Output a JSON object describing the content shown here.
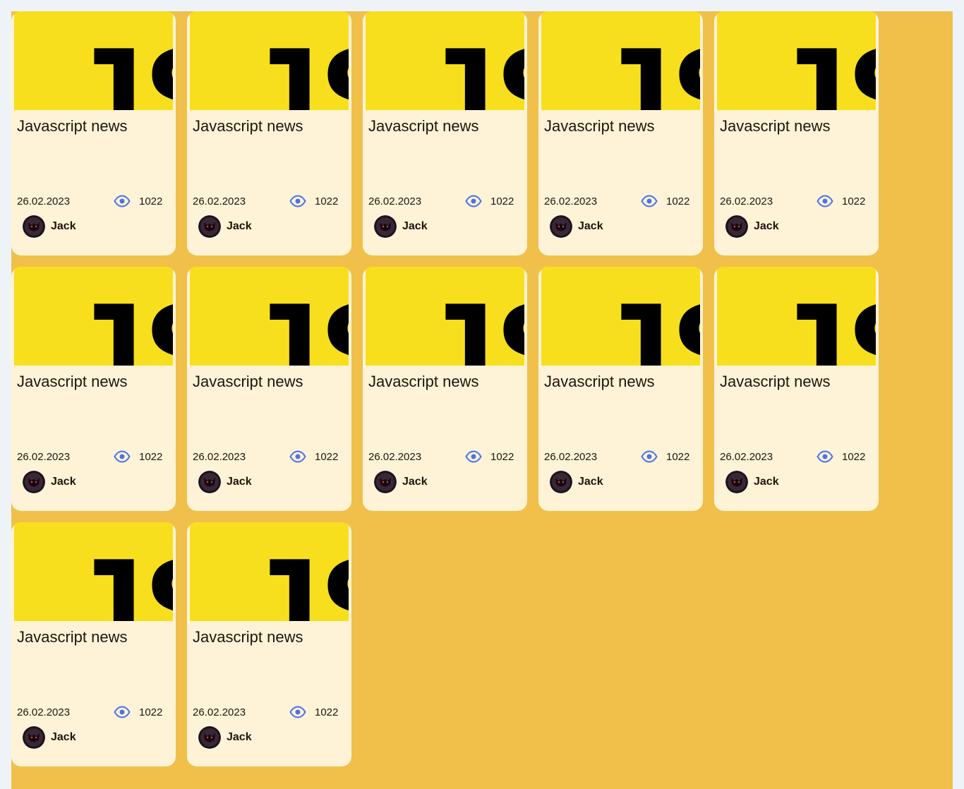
{
  "page": {
    "background_color": "#eef3f7",
    "board_color": "#f0c04a",
    "card_color": "#fff3d7",
    "accent_color": "#4b74e6",
    "thumbnail_color": "#f7df1e"
  },
  "cards": [
    {
      "thumbnail_text": "JS",
      "title": "Javascript news",
      "date": "26.02.2023",
      "views": "1022",
      "author": "Jack"
    },
    {
      "thumbnail_text": "JS",
      "title": "Javascript news",
      "date": "26.02.2023",
      "views": "1022",
      "author": "Jack"
    },
    {
      "thumbnail_text": "JS",
      "title": "Javascript news",
      "date": "26.02.2023",
      "views": "1022",
      "author": "Jack"
    },
    {
      "thumbnail_text": "JS",
      "title": "Javascript news",
      "date": "26.02.2023",
      "views": "1022",
      "author": "Jack"
    },
    {
      "thumbnail_text": "JS",
      "title": "Javascript news",
      "date": "26.02.2023",
      "views": "1022",
      "author": "Jack"
    },
    {
      "thumbnail_text": "JS",
      "title": "Javascript news",
      "date": "26.02.2023",
      "views": "1022",
      "author": "Jack"
    },
    {
      "thumbnail_text": "JS",
      "title": "Javascript news",
      "date": "26.02.2023",
      "views": "1022",
      "author": "Jack"
    },
    {
      "thumbnail_text": "JS",
      "title": "Javascript news",
      "date": "26.02.2023",
      "views": "1022",
      "author": "Jack"
    },
    {
      "thumbnail_text": "JS",
      "title": "Javascript news",
      "date": "26.02.2023",
      "views": "1022",
      "author": "Jack"
    },
    {
      "thumbnail_text": "JS",
      "title": "Javascript news",
      "date": "26.02.2023",
      "views": "1022",
      "author": "Jack"
    },
    {
      "thumbnail_text": "JS",
      "title": "Javascript news",
      "date": "26.02.2023",
      "views": "1022",
      "author": "Jack"
    },
    {
      "thumbnail_text": "JS",
      "title": "Javascript news",
      "date": "26.02.2023",
      "views": "1022",
      "author": "Jack"
    }
  ]
}
